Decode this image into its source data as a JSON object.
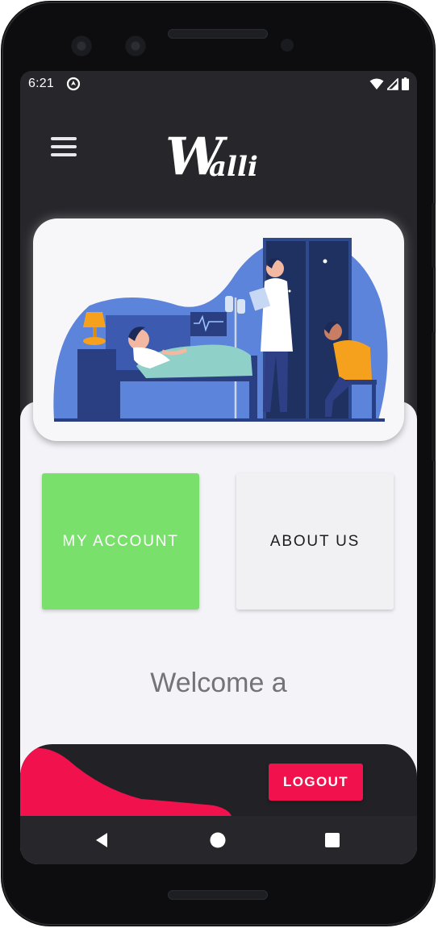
{
  "status_bar": {
    "time": "6:21",
    "icons": [
      "assistant-icon",
      "wifi-icon",
      "signal-icon",
      "battery-icon"
    ]
  },
  "header": {
    "logo_initial": "W",
    "logo_rest": "alli",
    "menu_icon": "hamburger-menu-icon"
  },
  "banner": {
    "illustration": "hospital-room-illustration"
  },
  "actions": {
    "my_account_label": "MY ACCOUNT",
    "about_us_label": "ABOUT US"
  },
  "welcome_text": "Welcome a",
  "footer": {
    "logout_label": "LOGOUT"
  },
  "nav": {
    "icons": [
      "back-icon",
      "home-icon",
      "recents-icon"
    ]
  },
  "colors": {
    "accent_green": "#79e06b",
    "logout_red": "#f0114d",
    "dark_bg": "#27272b",
    "content_bg": "#f4f3f8"
  }
}
